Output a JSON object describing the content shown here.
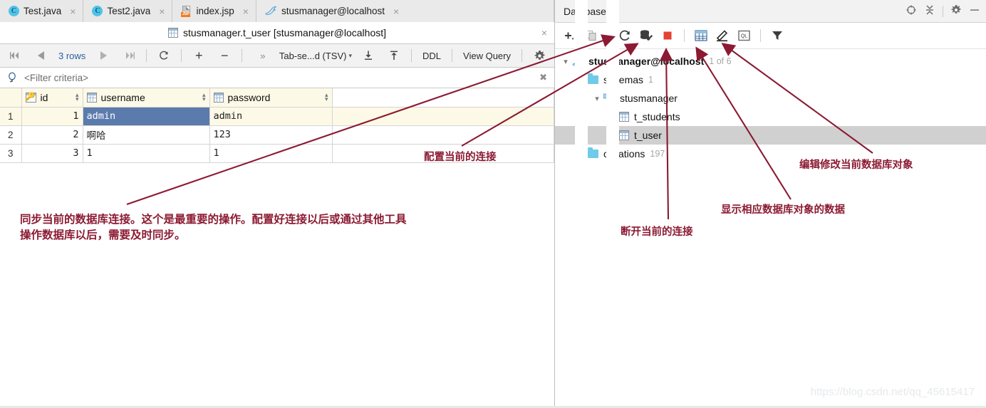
{
  "editor": {
    "tabs": [
      {
        "label": "Test.java",
        "icon": "java-class-icon",
        "active": false
      },
      {
        "label": "Test2.java",
        "icon": "java-class-icon",
        "active": false
      },
      {
        "label": "index.jsp",
        "icon": "jsp-file-icon",
        "active": false
      },
      {
        "label": "stusmanager@localhost",
        "icon": "mysql-dolphin-icon",
        "active": true
      }
    ],
    "close_glyph": "×",
    "title": "stusmanager.t_user [stusmanager@localhost]"
  },
  "toolbar": {
    "first_page": "first-page-icon",
    "prev_page": "prev-page-icon",
    "rows_label": "3 rows",
    "next_page": "next-page-icon",
    "last_page": "last-page-icon",
    "reload": "reload-icon",
    "add_row": "+",
    "remove_row": "−",
    "expand_glyph": "»",
    "format_label": "Tab-se...d (TSV)",
    "caret": "⌄",
    "export_icon": "export-data-icon",
    "import_icon": "import-data-icon",
    "ddl_label": "DDL",
    "view_query_label": "View Query",
    "settings_icon": "gear-icon"
  },
  "filter": {
    "icon": "search-icon",
    "placeholder": "<Filter criteria>",
    "clear_icon": "clear-filter-icon"
  },
  "grid": {
    "columns": [
      {
        "name": "id",
        "icon": "primary-key-icon",
        "sortable": true
      },
      {
        "name": "username",
        "icon": "table-column-icon",
        "sortable": true
      },
      {
        "name": "password",
        "icon": "table-column-icon",
        "sortable": true
      }
    ],
    "rows": [
      {
        "index": "1",
        "id": "1",
        "username": "admin",
        "password": "admin",
        "selected_cell": "username"
      },
      {
        "index": "2",
        "id": "2",
        "username": "啊哈",
        "password": "123",
        "selected_cell": null
      },
      {
        "index": "3",
        "id": "3",
        "username": "1",
        "password": "1",
        "selected_cell": null
      }
    ],
    "header_bg": "#fdf9e7",
    "selection_bg": "#5c7bad"
  },
  "database_panel": {
    "title": "Database",
    "header_icons": [
      {
        "name": "scroll-from-source-icon"
      },
      {
        "name": "collapse-all-icon"
      },
      {
        "name": "gear-icon"
      },
      {
        "name": "hide-icon"
      }
    ],
    "toolbar_icons": [
      {
        "name": "add-data-source-icon",
        "glyph": "+"
      },
      {
        "name": "duplicate-icon"
      },
      {
        "name": "synchronize-icon"
      },
      {
        "name": "data-source-properties-icon"
      },
      {
        "name": "stop-disconnect-icon",
        "color": "#e34234"
      },
      {
        "name": "table-editor-icon"
      },
      {
        "name": "modify-object-icon"
      },
      {
        "name": "query-console-icon",
        "glyph": "QL"
      },
      {
        "name": "filter-icon"
      }
    ],
    "tree": [
      {
        "label": "stusmanager@localhost",
        "count": "1 of 6",
        "icon": "mysql-dolphin-icon",
        "depth": 0,
        "expanded": true,
        "bold": true,
        "selected": false
      },
      {
        "label": "schemas",
        "count": "1",
        "icon": "folder-icon",
        "depth": 1,
        "expanded": true,
        "bold": false,
        "selected": false
      },
      {
        "label": "stusmanager",
        "count": "",
        "icon": "schema-icon",
        "depth": 2,
        "expanded": true,
        "bold": false,
        "selected": false
      },
      {
        "label": "t_students",
        "count": "",
        "icon": "table-icon",
        "depth": 3,
        "expanded": false,
        "bold": false,
        "selected": false
      },
      {
        "label": "t_user",
        "count": "",
        "icon": "table-icon",
        "depth": 3,
        "expanded": false,
        "bold": false,
        "selected": true
      },
      {
        "label": "collations",
        "count": "197",
        "icon": "folder-icon",
        "depth": 1,
        "expanded": false,
        "bold": false,
        "selected": false
      }
    ]
  },
  "annotations": [
    {
      "id": "configure-connection",
      "text": "配置当前的连接"
    },
    {
      "id": "sync-connection",
      "text": "同步当前的数据库连接。这个是最重要的操作。配置好连接以后或通过其他工具"
    },
    {
      "id": "sync-connection-line2",
      "text": "操作数据库以后，需要及时同步。"
    },
    {
      "id": "disconnect",
      "text": "断开当前的连接"
    },
    {
      "id": "show-data",
      "text": "显示相应数据库对象的数据"
    },
    {
      "id": "edit-object",
      "text": "编辑修改当前数据库对象"
    }
  ],
  "watermark": "https://blog.csdn.net/qq_45615417",
  "colors": {
    "annotation": "#8b1a32",
    "accent_blue": "#2b5f9e",
    "stop_red": "#e34234"
  }
}
